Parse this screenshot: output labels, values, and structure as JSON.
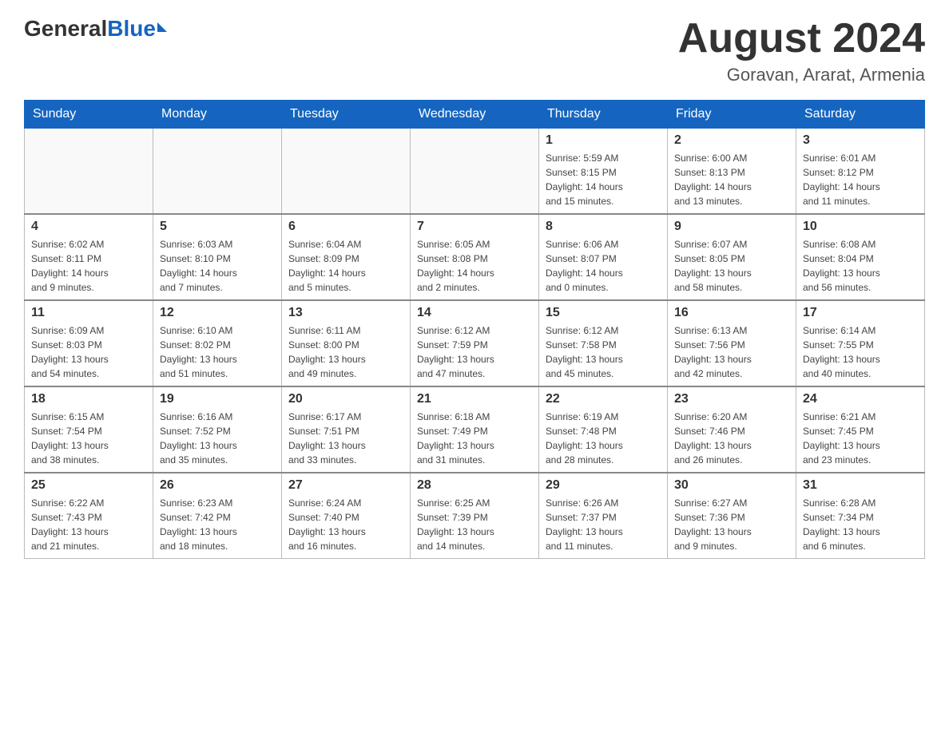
{
  "header": {
    "logo_general": "General",
    "logo_blue": "Blue",
    "month_title": "August 2024",
    "location": "Goravan, Ararat, Armenia"
  },
  "days_of_week": [
    "Sunday",
    "Monday",
    "Tuesday",
    "Wednesday",
    "Thursday",
    "Friday",
    "Saturday"
  ],
  "weeks": [
    [
      {
        "day": "",
        "info": ""
      },
      {
        "day": "",
        "info": ""
      },
      {
        "day": "",
        "info": ""
      },
      {
        "day": "",
        "info": ""
      },
      {
        "day": "1",
        "info": "Sunrise: 5:59 AM\nSunset: 8:15 PM\nDaylight: 14 hours\nand 15 minutes."
      },
      {
        "day": "2",
        "info": "Sunrise: 6:00 AM\nSunset: 8:13 PM\nDaylight: 14 hours\nand 13 minutes."
      },
      {
        "day": "3",
        "info": "Sunrise: 6:01 AM\nSunset: 8:12 PM\nDaylight: 14 hours\nand 11 minutes."
      }
    ],
    [
      {
        "day": "4",
        "info": "Sunrise: 6:02 AM\nSunset: 8:11 PM\nDaylight: 14 hours\nand 9 minutes."
      },
      {
        "day": "5",
        "info": "Sunrise: 6:03 AM\nSunset: 8:10 PM\nDaylight: 14 hours\nand 7 minutes."
      },
      {
        "day": "6",
        "info": "Sunrise: 6:04 AM\nSunset: 8:09 PM\nDaylight: 14 hours\nand 5 minutes."
      },
      {
        "day": "7",
        "info": "Sunrise: 6:05 AM\nSunset: 8:08 PM\nDaylight: 14 hours\nand 2 minutes."
      },
      {
        "day": "8",
        "info": "Sunrise: 6:06 AM\nSunset: 8:07 PM\nDaylight: 14 hours\nand 0 minutes."
      },
      {
        "day": "9",
        "info": "Sunrise: 6:07 AM\nSunset: 8:05 PM\nDaylight: 13 hours\nand 58 minutes."
      },
      {
        "day": "10",
        "info": "Sunrise: 6:08 AM\nSunset: 8:04 PM\nDaylight: 13 hours\nand 56 minutes."
      }
    ],
    [
      {
        "day": "11",
        "info": "Sunrise: 6:09 AM\nSunset: 8:03 PM\nDaylight: 13 hours\nand 54 minutes."
      },
      {
        "day": "12",
        "info": "Sunrise: 6:10 AM\nSunset: 8:02 PM\nDaylight: 13 hours\nand 51 minutes."
      },
      {
        "day": "13",
        "info": "Sunrise: 6:11 AM\nSunset: 8:00 PM\nDaylight: 13 hours\nand 49 minutes."
      },
      {
        "day": "14",
        "info": "Sunrise: 6:12 AM\nSunset: 7:59 PM\nDaylight: 13 hours\nand 47 minutes."
      },
      {
        "day": "15",
        "info": "Sunrise: 6:12 AM\nSunset: 7:58 PM\nDaylight: 13 hours\nand 45 minutes."
      },
      {
        "day": "16",
        "info": "Sunrise: 6:13 AM\nSunset: 7:56 PM\nDaylight: 13 hours\nand 42 minutes."
      },
      {
        "day": "17",
        "info": "Sunrise: 6:14 AM\nSunset: 7:55 PM\nDaylight: 13 hours\nand 40 minutes."
      }
    ],
    [
      {
        "day": "18",
        "info": "Sunrise: 6:15 AM\nSunset: 7:54 PM\nDaylight: 13 hours\nand 38 minutes."
      },
      {
        "day": "19",
        "info": "Sunrise: 6:16 AM\nSunset: 7:52 PM\nDaylight: 13 hours\nand 35 minutes."
      },
      {
        "day": "20",
        "info": "Sunrise: 6:17 AM\nSunset: 7:51 PM\nDaylight: 13 hours\nand 33 minutes."
      },
      {
        "day": "21",
        "info": "Sunrise: 6:18 AM\nSunset: 7:49 PM\nDaylight: 13 hours\nand 31 minutes."
      },
      {
        "day": "22",
        "info": "Sunrise: 6:19 AM\nSunset: 7:48 PM\nDaylight: 13 hours\nand 28 minutes."
      },
      {
        "day": "23",
        "info": "Sunrise: 6:20 AM\nSunset: 7:46 PM\nDaylight: 13 hours\nand 26 minutes."
      },
      {
        "day": "24",
        "info": "Sunrise: 6:21 AM\nSunset: 7:45 PM\nDaylight: 13 hours\nand 23 minutes."
      }
    ],
    [
      {
        "day": "25",
        "info": "Sunrise: 6:22 AM\nSunset: 7:43 PM\nDaylight: 13 hours\nand 21 minutes."
      },
      {
        "day": "26",
        "info": "Sunrise: 6:23 AM\nSunset: 7:42 PM\nDaylight: 13 hours\nand 18 minutes."
      },
      {
        "day": "27",
        "info": "Sunrise: 6:24 AM\nSunset: 7:40 PM\nDaylight: 13 hours\nand 16 minutes."
      },
      {
        "day": "28",
        "info": "Sunrise: 6:25 AM\nSunset: 7:39 PM\nDaylight: 13 hours\nand 14 minutes."
      },
      {
        "day": "29",
        "info": "Sunrise: 6:26 AM\nSunset: 7:37 PM\nDaylight: 13 hours\nand 11 minutes."
      },
      {
        "day": "30",
        "info": "Sunrise: 6:27 AM\nSunset: 7:36 PM\nDaylight: 13 hours\nand 9 minutes."
      },
      {
        "day": "31",
        "info": "Sunrise: 6:28 AM\nSunset: 7:34 PM\nDaylight: 13 hours\nand 6 minutes."
      }
    ]
  ]
}
